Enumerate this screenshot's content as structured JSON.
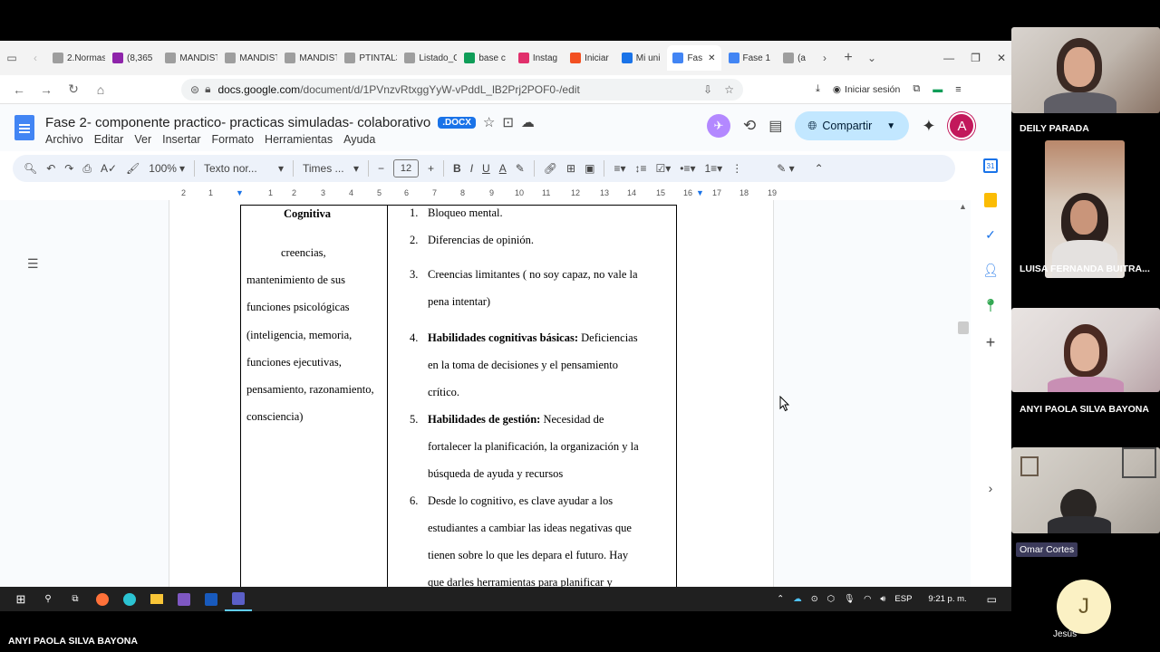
{
  "browser": {
    "tabs": [
      {
        "label": "2.Normas",
        "color": "#9e9e9e"
      },
      {
        "label": "(8,365",
        "color": "#8e24aa"
      },
      {
        "label": "MANDISTI",
        "color": "#9e9e9e"
      },
      {
        "label": "MANDISTI",
        "color": "#9e9e9e"
      },
      {
        "label": "MANDISTI",
        "color": "#9e9e9e"
      },
      {
        "label": "PTINTAL3_",
        "color": "#9e9e9e"
      },
      {
        "label": "Listado_C",
        "color": "#9e9e9e"
      },
      {
        "label": "base c",
        "color": "#0f9d58"
      },
      {
        "label": "Instag",
        "color": "#e1306c"
      },
      {
        "label": "Iniciar",
        "color": "#f25022"
      },
      {
        "label": "Mi uni",
        "color": "#1a73e8"
      }
    ],
    "active_tab": "Fas",
    "after_tabs": [
      {
        "label": "Fase 1",
        "color": "#4285f4"
      },
      {
        "label": "(a",
        "color": "#9e9e9e"
      }
    ],
    "url_domain": "docs.google.com",
    "url_path": "/document/d/1PVnzvRtxggYyW-vPddL_lB2Prj2POF0-/edit",
    "signin_label": "Iniciar sesión"
  },
  "doc": {
    "title": "Fase 2- componente practico- practicas simuladas- colaborativo",
    "badge": ".DOCX",
    "menu": [
      "Archivo",
      "Editar",
      "Ver",
      "Insertar",
      "Formato",
      "Herramientas",
      "Ayuda"
    ],
    "share_label": "Compartir",
    "avatar_letter": "A",
    "zoom": "100%",
    "style": "Texto nor...",
    "font": "Times ...",
    "font_size": "12",
    "ruler_ticks": [
      "2",
      "1",
      "1",
      "2",
      "3",
      "4",
      "5",
      "6",
      "7",
      "8",
      "9",
      "10",
      "11",
      "12",
      "13",
      "14",
      "15",
      "16",
      "17",
      "18",
      "19"
    ]
  },
  "table": {
    "col1_header": "Cognitiva",
    "col1_lines": [
      "creencias,",
      "mantenimiento de sus",
      "funciones psicológicas",
      "(inteligencia, memoria,",
      "funciones ejecutivas,",
      "pensamiento, razonamiento,",
      "consciencia)"
    ],
    "items": [
      {
        "num": "1.",
        "bold": "",
        "lines": [
          "Bloqueo mental."
        ]
      },
      {
        "num": "2.",
        "bold": "",
        "lines": [
          "Diferencias de opinión."
        ]
      },
      {
        "num": "3.",
        "bold": "",
        "lines": [
          "Creencias limitantes ( no soy capaz, no vale la",
          "pena intentar)"
        ]
      },
      {
        "num": "4.",
        "bold": "Habilidades cognitivas básicas:",
        "first_rest": " Deficiencias",
        "lines": [
          "en la toma de decisiones y el pensamiento",
          "crítico."
        ]
      },
      {
        "num": "5.",
        "bold": "Habilidades de gestión:",
        "first_rest": " Necesidad de",
        "lines": [
          "fortalecer la planificación, la organización y la",
          "búsqueda de ayuda y recursos"
        ]
      },
      {
        "num": "6.",
        "bold": "",
        "lines": [
          "Desde lo cognitivo, es clave ayudar a los",
          "estudiantes a cambiar las ideas negativas que",
          "tienen sobre lo que les depara el futuro. Hay",
          "que darles herramientas para planificar y"
        ]
      }
    ]
  },
  "taskbar": {
    "lang": "ESP",
    "time": "9:21 p. m."
  },
  "participants": [
    {
      "name": "DEILY PARADA"
    },
    {
      "name": "LUISA FERNANDA BUITRA..."
    },
    {
      "name": "ANYI PAOLA SILVA BAYONA"
    },
    {
      "name": "Omar Cortes"
    },
    {
      "name": "Jesús",
      "initial": "J"
    }
  ],
  "presenter_name": "ANYI PAOLA SILVA BAYONA"
}
